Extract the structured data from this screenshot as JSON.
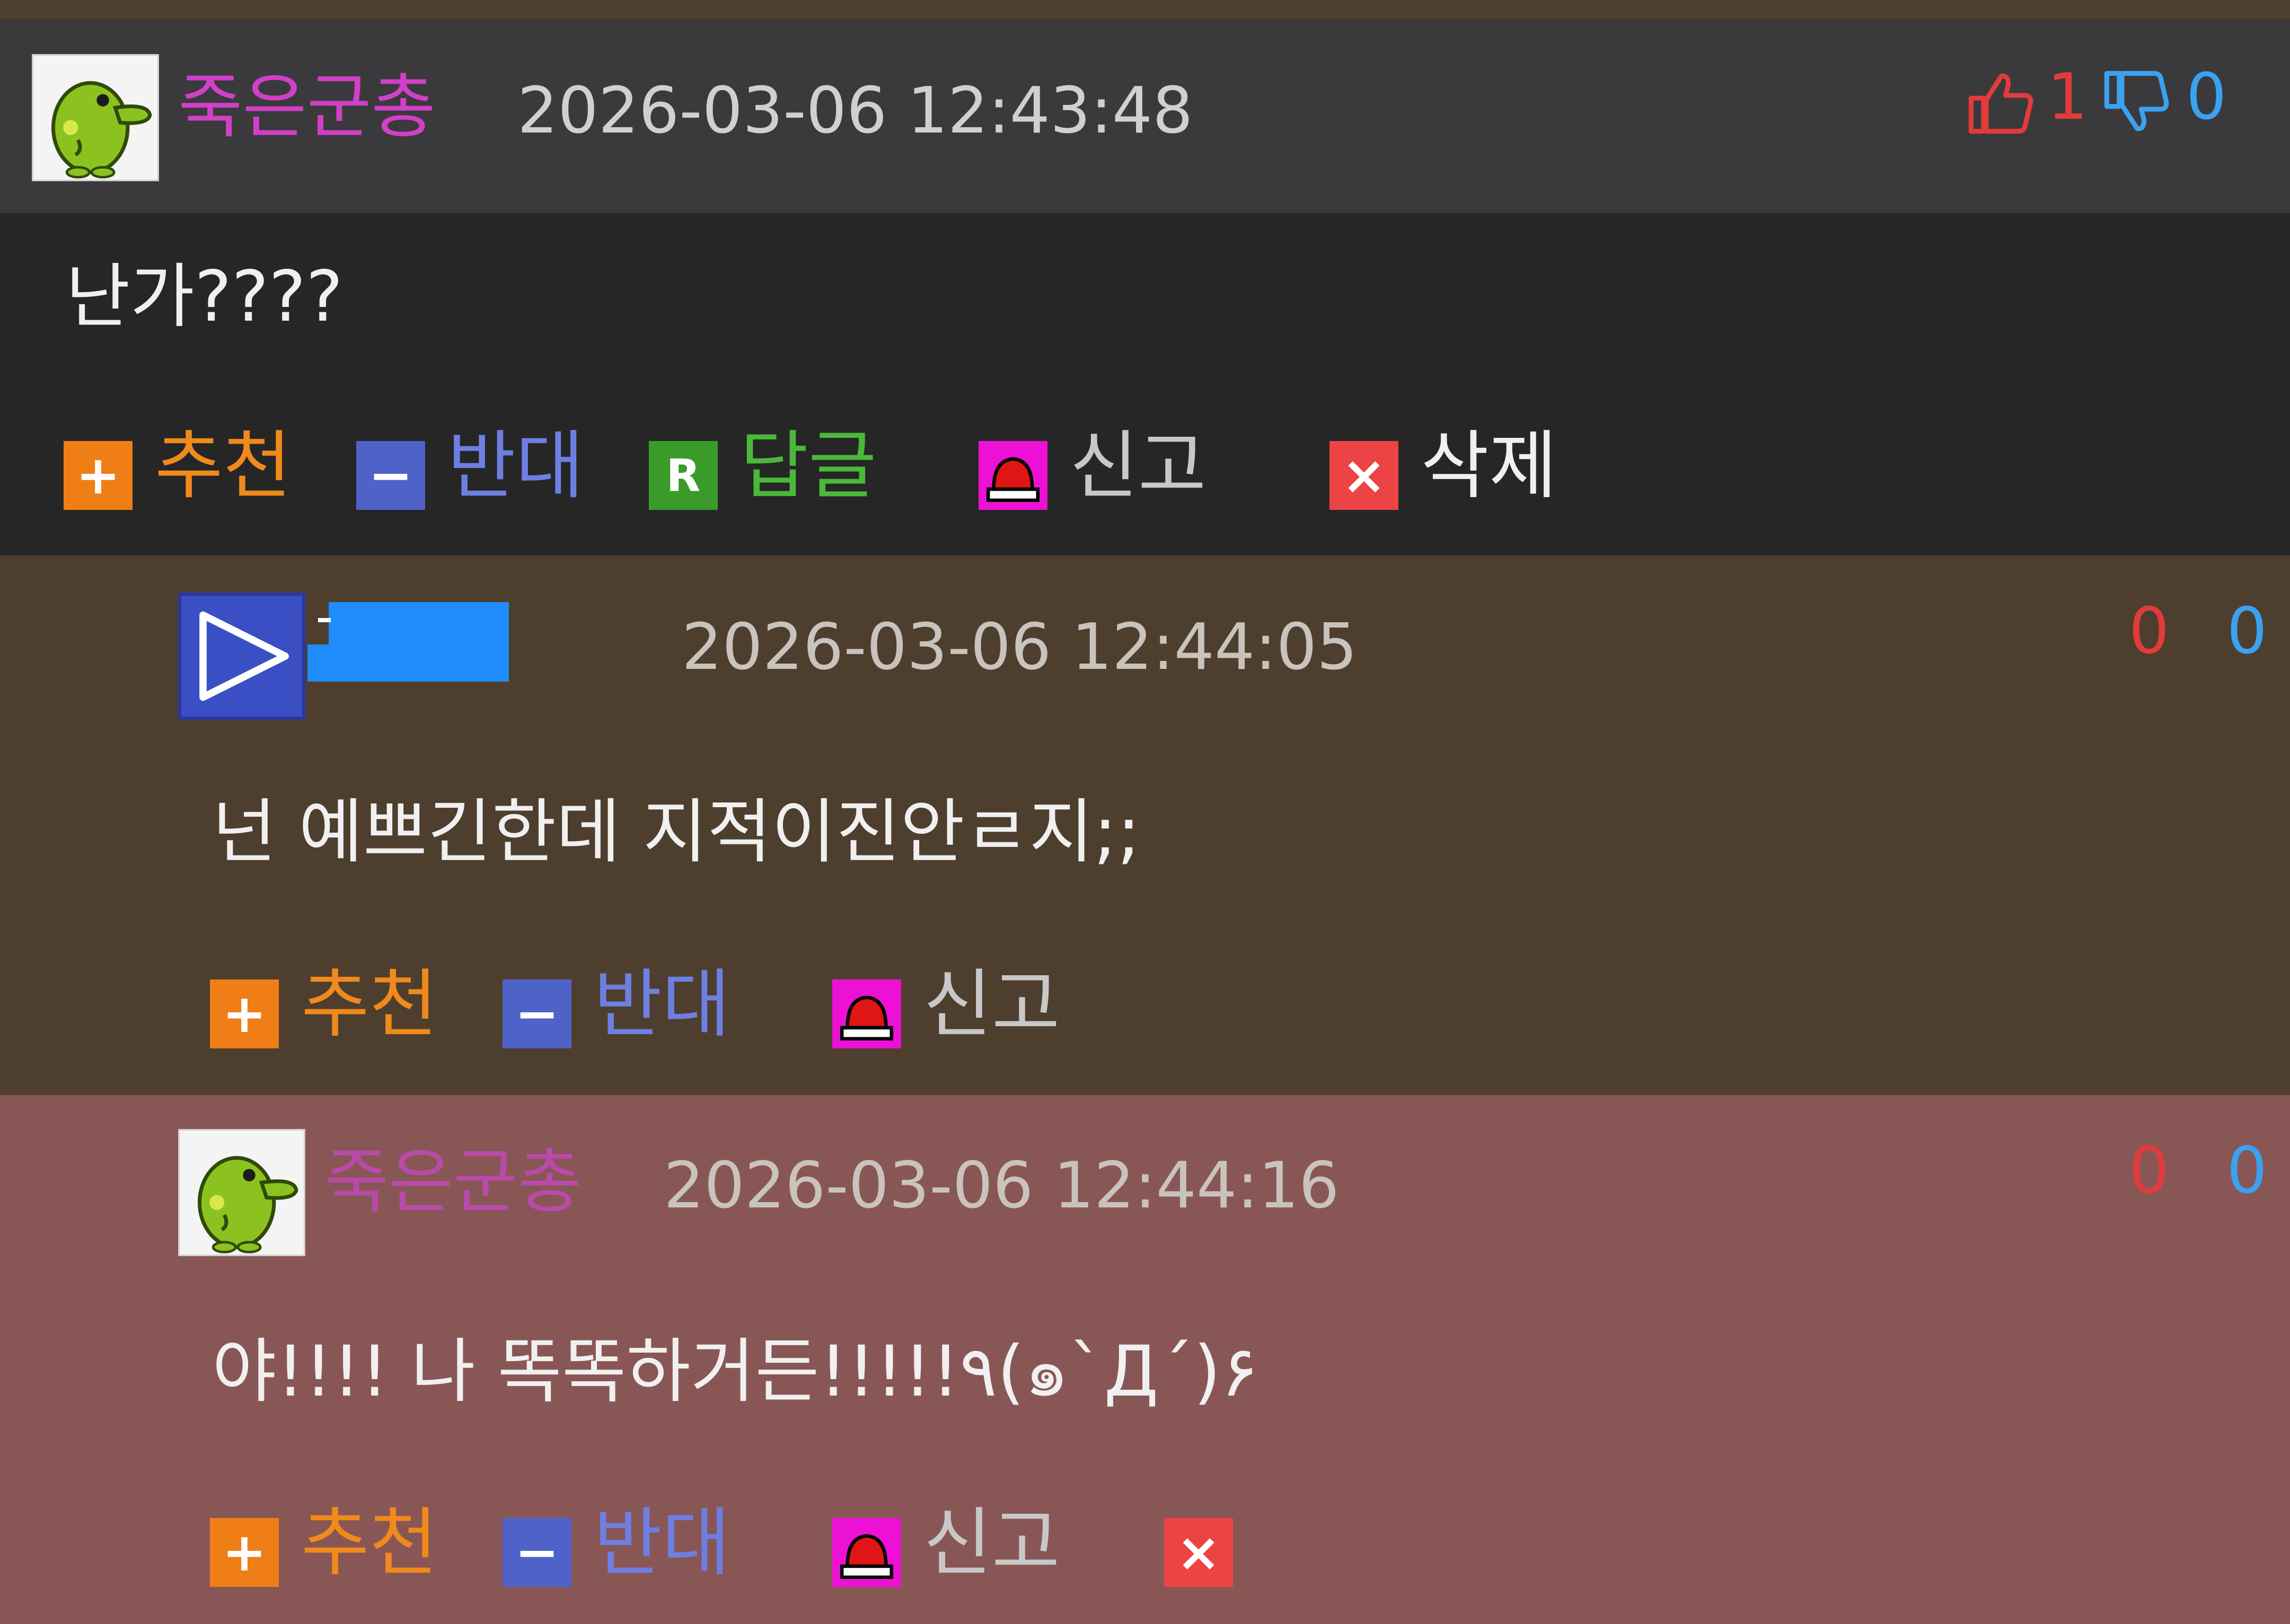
{
  "colors": {
    "nickname": "#d23fc8",
    "upvote": "#e23b3b",
    "downvote": "#3aa2f0",
    "recommend": "#f08a1c",
    "oppose": "#6e7fe2",
    "reply": "#4ab83a",
    "report": "#ec11d4",
    "delete": "#ec4444"
  },
  "main_comment": {
    "nickname": "죽은군총",
    "timestamp": "2026-03-06 12:43:48",
    "upvotes": "1",
    "downvotes": "0",
    "text": "난가????",
    "actions": {
      "recommend": "추천",
      "oppose": "반대",
      "reply": "답글",
      "report": "신고",
      "delete": "삭제"
    },
    "icons": [
      "thumbs-up-icon",
      "thumbs-down-icon",
      "plus-icon",
      "minus-icon",
      "reply-r-icon",
      "siren-icon",
      "close-icon"
    ]
  },
  "reply_1": {
    "timestamp": "2026-03-06 12:44:05",
    "upvotes": "0",
    "downvotes": "0",
    "text": "넌 예쁘긴한데 지적이진안ㄹ지;;",
    "actions": {
      "recommend": "추천",
      "oppose": "반대",
      "report": "신고"
    }
  },
  "reply_2": {
    "nickname": "죽은군총",
    "timestamp": "2026-03-06 12:44:16",
    "upvotes": "0",
    "downvotes": "0",
    "text": "야!!!! 나 똑똑하거든!!!!!٩(๑`Д´)۶",
    "actions": {
      "recommend": "추천",
      "oppose": "반대",
      "report": "신고"
    }
  }
}
